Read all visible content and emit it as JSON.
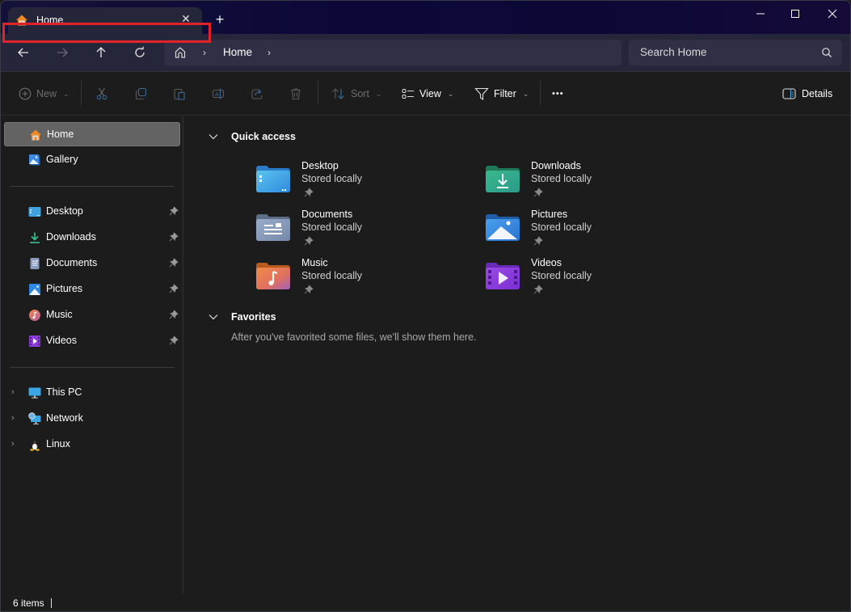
{
  "window": {
    "tab_title": "Home",
    "new_tab_symbol": "+",
    "close_tab_symbol": "✕"
  },
  "nav": {
    "breadcrumb": [
      "Home"
    ],
    "search_placeholder": "Search Home"
  },
  "commands": {
    "new": "New",
    "sort": "Sort",
    "view": "View",
    "filter": "Filter",
    "more": "•••",
    "details": "Details"
  },
  "sidebar": {
    "top": [
      {
        "label": "Home",
        "icon": "home-icon",
        "active": true
      },
      {
        "label": "Gallery",
        "icon": "gallery-icon"
      }
    ],
    "pinned": [
      {
        "label": "Desktop",
        "icon": "desktop-folder-icon"
      },
      {
        "label": "Downloads",
        "icon": "downloads-icon"
      },
      {
        "label": "Documents",
        "icon": "documents-icon"
      },
      {
        "label": "Pictures",
        "icon": "pictures-icon"
      },
      {
        "label": "Music",
        "icon": "music-icon"
      },
      {
        "label": "Videos",
        "icon": "videos-icon"
      }
    ],
    "locations": [
      {
        "label": "This PC",
        "icon": "pc-icon"
      },
      {
        "label": "Network",
        "icon": "network-icon"
      },
      {
        "label": "Linux",
        "icon": "linux-icon"
      }
    ]
  },
  "main": {
    "quick_access_title": "Quick access",
    "quick_access": [
      {
        "name": "Desktop",
        "sub": "Stored locally",
        "icon": "desktop-folder-icon",
        "color": "#3a9ee0"
      },
      {
        "name": "Downloads",
        "sub": "Stored locally",
        "icon": "downloads-folder-icon",
        "color": "#2fa57e"
      },
      {
        "name": "Documents",
        "sub": "Stored locally",
        "icon": "documents-folder-icon",
        "color": "#7c8db0"
      },
      {
        "name": "Pictures",
        "sub": "Stored locally",
        "icon": "pictures-folder-icon",
        "color": "#2f7fd8"
      },
      {
        "name": "Music",
        "sub": "Stored locally",
        "icon": "music-folder-icon",
        "color": "#e8784a"
      },
      {
        "name": "Videos",
        "sub": "Stored locally",
        "icon": "videos-folder-icon",
        "color": "#8a3fd8"
      }
    ],
    "favorites_title": "Favorites",
    "favorites_empty": "After you've favorited some files, we'll show them here."
  },
  "status": {
    "item_count": "6 items"
  }
}
